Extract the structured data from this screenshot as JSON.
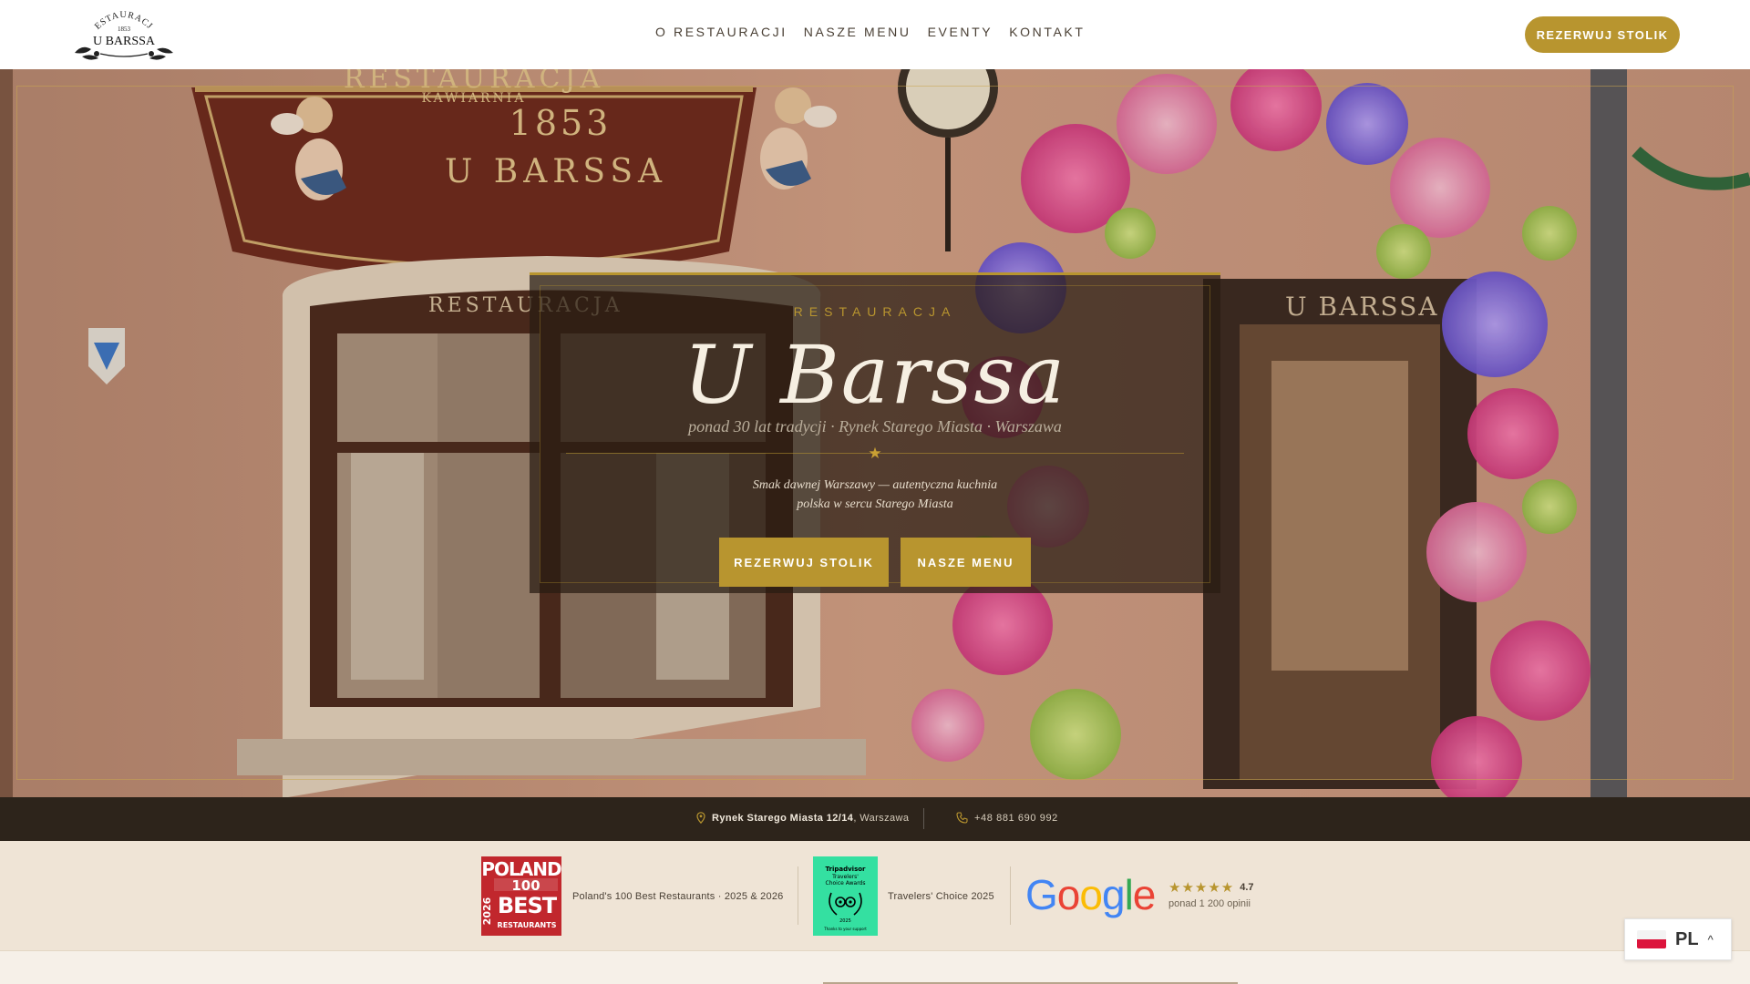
{
  "header": {
    "logo_arch_text": "RESTAURACJA",
    "logo_year": "1853",
    "logo_name": "U BARSSA",
    "nav": [
      {
        "label": "O RESTAURACJI"
      },
      {
        "label": "NASZE MENU"
      },
      {
        "label": "EVENTY"
      },
      {
        "label": "KONTAKT"
      }
    ],
    "cta_label": "REZERWUJ STOLIK"
  },
  "hero": {
    "sign_main_arch": "RESTAURACJA",
    "sign_sub_arch": "KAWIARNIA",
    "sign_year": "1853",
    "sign_name": "U BARSSA",
    "window_sign": "RESTAURACJA",
    "door_sign": "U BARSSA",
    "card": {
      "eyebrow": "RESTAURACJA",
      "title": "U Barssa",
      "subtitle": "ponad 30 lat tradycji · Rynek Starego Miasta · Warszawa",
      "star": "★",
      "tagline_line1": "Smak dawnej Warszawy — autentyczna kuchnia",
      "tagline_line2": "polska w sercu Starego Miasta",
      "btn_reserve": "REZERWUJ STOLIK",
      "btn_menu": "NASZE MENU"
    }
  },
  "infobar": {
    "address_bold": "Rynek Starego Miasta 12/14",
    "address_city": ", Warszawa",
    "phone": "+48 881 690 992"
  },
  "awards": {
    "poland100_badge": {
      "line1": "POLAND",
      "number": "100",
      "line2": "BEST",
      "line3": "RESTAURANTS",
      "year": "2026"
    },
    "poland100_text": "Poland's 100 Best Restaurants · 2025 & 2026",
    "tripadvisor_badge": {
      "brand": "Tripadvisor",
      "title1": "Travelers'",
      "title2": "Choice Awards",
      "year": "2025",
      "foot": "Thanks to your support"
    },
    "tripadvisor_text": "Travelers' Choice 2025",
    "google_word": [
      "G",
      "o",
      "o",
      "g",
      "l",
      "e"
    ],
    "google_colors": [
      "#4285F4",
      "#EA4335",
      "#FBBC05",
      "#4285F4",
      "#34A853",
      "#EA4335"
    ],
    "rating_stars": "★★★★★",
    "rating_value": "4.7",
    "reviews": "ponad 1 200 opinii"
  },
  "language": {
    "code": "PL",
    "chevron": "^"
  },
  "colors": {
    "gold": "#b8952f",
    "dark": "#2d241b",
    "cream": "#efe4d6"
  }
}
